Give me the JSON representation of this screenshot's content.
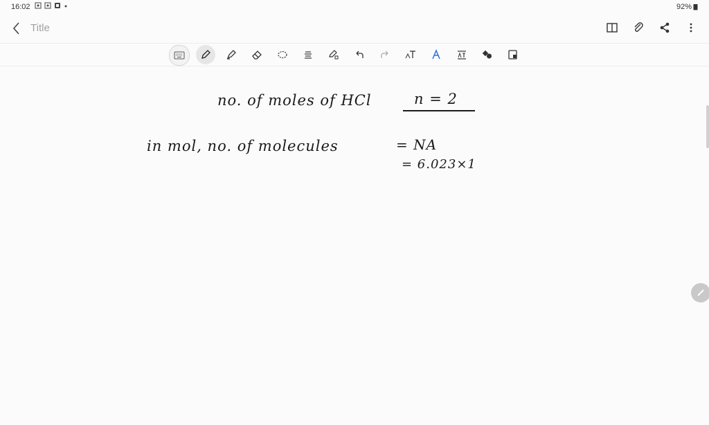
{
  "status": {
    "time": "16:02",
    "battery": "92%"
  },
  "header": {
    "title": "Title"
  },
  "toolbar": {
    "tools": [
      {
        "name": "keyboard-tool",
        "icon": "keyboard-icon"
      },
      {
        "name": "pen-tool",
        "icon": "pen-icon"
      },
      {
        "name": "highlighter-tool",
        "icon": "highlighter-icon"
      },
      {
        "name": "eraser-tool",
        "icon": "eraser-icon"
      },
      {
        "name": "lasso-tool",
        "icon": "lasso-icon"
      },
      {
        "name": "select-text-tool",
        "icon": "text-align-icon"
      },
      {
        "name": "shape-pen-tool",
        "icon": "shape-pen-icon"
      },
      {
        "name": "undo-button",
        "icon": "undo-icon"
      },
      {
        "name": "redo-button",
        "icon": "redo-icon"
      },
      {
        "name": "text-tool",
        "icon": "text-icon"
      },
      {
        "name": "handwriting-tool",
        "icon": "handwriting-icon"
      },
      {
        "name": "convert-text-tool",
        "icon": "convert-text-icon"
      },
      {
        "name": "shapes-tool",
        "icon": "shapes-icon"
      },
      {
        "name": "image-tool",
        "icon": "image-icon"
      }
    ]
  },
  "note": {
    "line1": "no. of moles of HCl",
    "line1_value": "n = 2",
    "line2": "in mol, no. of molecules",
    "line2_value": "= NA",
    "line3": "= 6.023×1"
  },
  "colors": {
    "ink": "#1a1a1a",
    "background": "#fbfbfb",
    "title_placeholder": "#a0a0a0"
  }
}
